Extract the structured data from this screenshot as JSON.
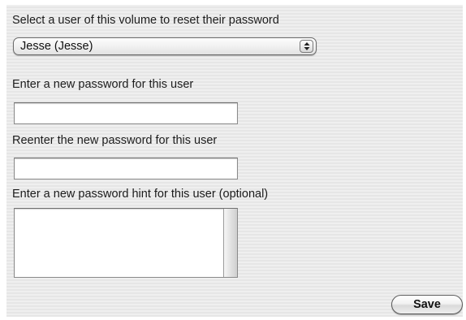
{
  "user_select": {
    "label": "Select a user of this volume to reset their password",
    "selected_value": "Jesse (Jesse)"
  },
  "new_password": {
    "label": "Enter a new password for this user",
    "value": ""
  },
  "reenter_password": {
    "label": "Reenter the new password for this user",
    "value": ""
  },
  "password_hint": {
    "label": "Enter a new password hint for this user (optional)",
    "value": ""
  },
  "actions": {
    "save_label": "Save"
  },
  "icons": {
    "popup_arrows": "up-down-arrows-icon"
  },
  "colors": {
    "panel_background": "#ececec",
    "text": "#1c1c1c",
    "field_border": "#8a8a8a"
  }
}
